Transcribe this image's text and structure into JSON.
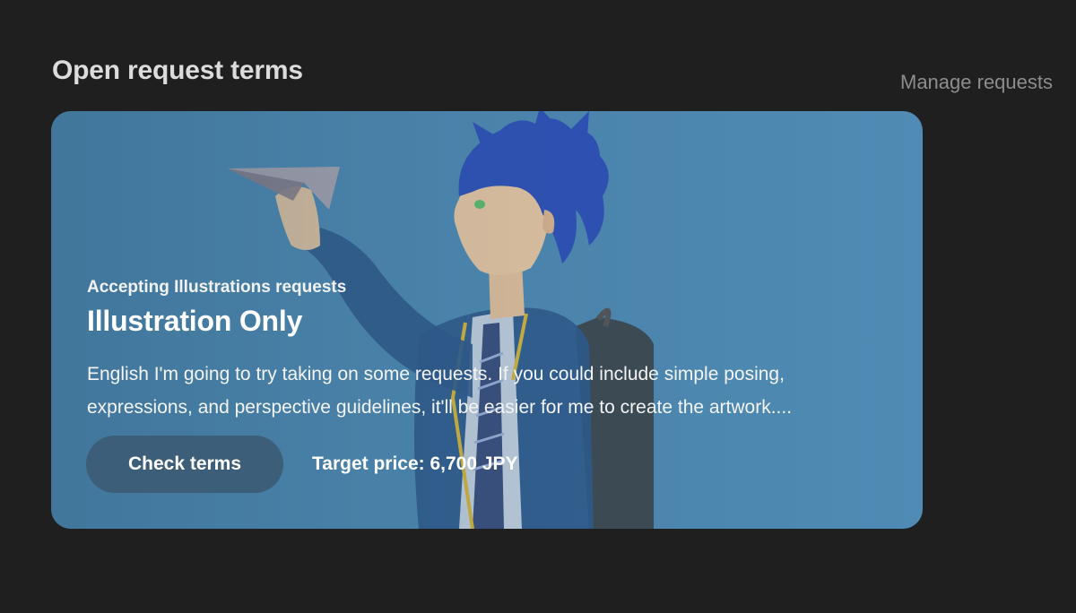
{
  "section": {
    "title": "Open request terms",
    "manage_link": "Manage requests"
  },
  "card": {
    "eyebrow": "Accepting Illustrations requests",
    "title": "Illustration Only",
    "description": "English I'm going to try taking on some requests. If you could include simple posing, expressions, and perspective guidelines, it'll be easier for me to create the artwork....",
    "check_button": "Check terms",
    "target_price": "Target price: 6,700 JPY",
    "background_color": "#4f8bb4",
    "button_color": "#3c5e78"
  }
}
